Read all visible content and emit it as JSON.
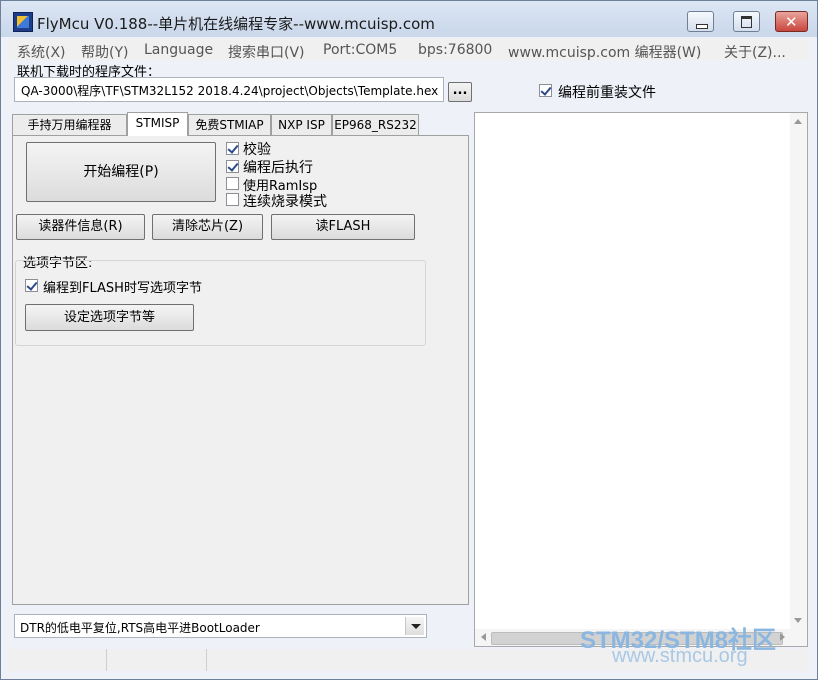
{
  "window": {
    "title": "FlyMcu V0.188--单片机在线编程专家--www.mcuisp.com"
  },
  "menu": {
    "items": [
      "系统(X)",
      "帮助(Y)",
      "Language",
      "搜索串口(V)",
      "Port:COM5",
      "bps:76800",
      "www.mcuisp.com 编程器(W)",
      "关于(Z)..."
    ]
  },
  "file": {
    "label": "联机下载时的程序文件：",
    "path": "QA-3000\\程序\\TF\\STM32L152  2018.4.24\\project\\Objects\\Template.hex",
    "browse_label": "...",
    "reload_label": "编程前重装文件",
    "reload_checked": true
  },
  "tabs": [
    {
      "label": "手持万用编程器",
      "active": false
    },
    {
      "label": "STMISP",
      "active": true
    },
    {
      "label": "免费STMIAP",
      "active": false
    },
    {
      "label": "NXP ISP",
      "active": false
    },
    {
      "label": "EP968_RS232",
      "active": false
    }
  ],
  "stmisp": {
    "start_label": "开始编程(P)",
    "options": [
      {
        "label": "校验",
        "checked": true
      },
      {
        "label": "编程后执行",
        "checked": true
      },
      {
        "label": "使用RamIsp",
        "checked": false
      },
      {
        "label": "连续烧录模式",
        "checked": false
      }
    ],
    "read_info_label": "读器件信息(R)",
    "erase_label": "清除芯片(Z)",
    "read_flash_label": "读FLASH",
    "option_group_label": "选项字节区:",
    "write_option_label": "编程到FLASH时写选项字节",
    "write_option_checked": true,
    "set_option_label": "设定选项字节等"
  },
  "boot_mode": {
    "selected": "DTR的低电平复位,RTS高电平进BootLoader"
  },
  "watermark": {
    "line1": "STM32/STM8社区",
    "line2": "www.stmcu.org"
  },
  "icons": {
    "app": "flymcu-app-icon",
    "minimize": "minimize-icon",
    "maximize": "maximize-icon",
    "close": "close-icon",
    "dropdown": "dropdown-arrow-icon",
    "scroll_up": "scroll-up-arrow-icon",
    "scroll_down": "scroll-down-arrow-icon",
    "scroll_left": "scroll-left-arrow-icon",
    "scroll_right": "scroll-right-arrow-icon"
  },
  "colors": {
    "close_button": "#c9463d",
    "watermark": "#6fa3d9"
  }
}
